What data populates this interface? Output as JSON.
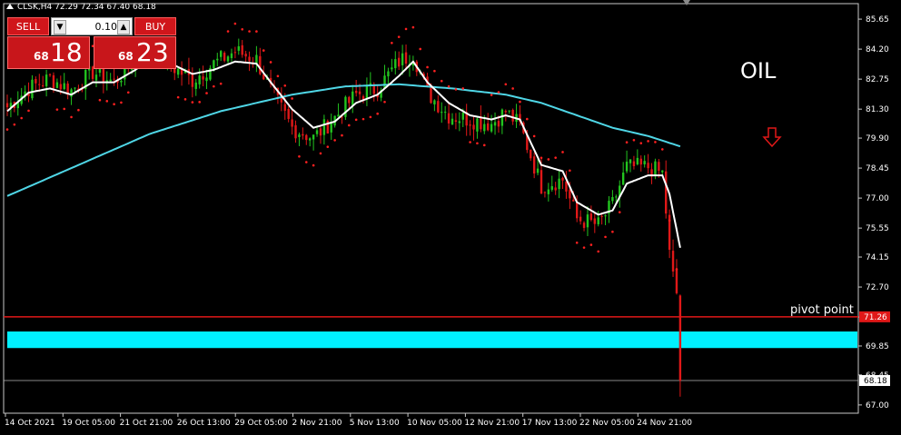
{
  "header": {
    "symbol_info": "CLSK,H4  72.29 72.34 67.40 68.18"
  },
  "trade_panel": {
    "sell_label": "SELL",
    "buy_label": "BUY",
    "lot_value": "0.10",
    "sell_price_small": "68",
    "sell_price_big": "18",
    "buy_price_small": "68",
    "buy_price_big": "23"
  },
  "annotations": {
    "oil_text": "OIL",
    "pivot_text": "pivot point"
  },
  "colors": {
    "bull": "#22c41f",
    "bear": "#e01818",
    "ma_fast": "#ffffff",
    "ma_slow": "#4fd6e6",
    "sar": "#ff2020",
    "zone": "#00f0ff",
    "pivot_line": "#e01818"
  },
  "chart_data": {
    "type": "candlestick",
    "ylim": [
      66.6,
      86.4
    ],
    "y_ticks": [
      "85.65",
      "84.20",
      "82.75",
      "81.30",
      "79.90",
      "78.45",
      "77.00",
      "75.55",
      "74.15",
      "72.70",
      "71.25",
      "69.85",
      "68.45",
      "67.00"
    ],
    "x_ticks": [
      "14 Oct 2021",
      "19 Oct 05:00",
      "21 Oct 21:00",
      "26 Oct 13:00",
      "29 Oct 05:00",
      "2 Nov 21:00",
      "5 Nov 13:00",
      "10 Nov 05:00",
      "12 Nov 21:00",
      "17 Nov 13:00",
      "22 Nov 05:00",
      "24 Nov 21:00"
    ],
    "current_price": "68.18",
    "pivot_price": "71.26",
    "pivot_value": 71.26,
    "zone": [
      69.75,
      70.55
    ],
    "anchors": [
      [
        0,
        81.4
      ],
      [
        6,
        82.3
      ],
      [
        12,
        82.8
      ],
      [
        18,
        82.2
      ],
      [
        24,
        83.1
      ],
      [
        30,
        82.6
      ],
      [
        36,
        83.7
      ],
      [
        40,
        84.2
      ],
      [
        46,
        83.4
      ],
      [
        52,
        82.7
      ],
      [
        58,
        83.5
      ],
      [
        64,
        84.1
      ],
      [
        70,
        83.7
      ],
      [
        74,
        82.2
      ],
      [
        80,
        80.4
      ],
      [
        86,
        79.9
      ],
      [
        92,
        80.9
      ],
      [
        98,
        82.0
      ],
      [
        104,
        82.3
      ],
      [
        110,
        83.6
      ],
      [
        114,
        84.0
      ],
      [
        118,
        82.1
      ],
      [
        124,
        81.0
      ],
      [
        130,
        80.8
      ],
      [
        136,
        80.6
      ],
      [
        140,
        81.2
      ],
      [
        144,
        80.5
      ],
      [
        150,
        77.6
      ],
      [
        156,
        77.9
      ],
      [
        160,
        76.0
      ],
      [
        166,
        75.7
      ],
      [
        170,
        76.7
      ],
      [
        174,
        78.5
      ],
      [
        180,
        78.5
      ],
      [
        184,
        78.2
      ],
      [
        186,
        74.5
      ],
      [
        188,
        72.4
      ],
      [
        189,
        68.2
      ]
    ],
    "ma_slow": [
      [
        0,
        77.1
      ],
      [
        20,
        78.6
      ],
      [
        40,
        80.1
      ],
      [
        60,
        81.2
      ],
      [
        80,
        82.0
      ],
      [
        95,
        82.4
      ],
      [
        110,
        82.5
      ],
      [
        125,
        82.3
      ],
      [
        140,
        82.0
      ],
      [
        150,
        81.6
      ],
      [
        160,
        81.0
      ],
      [
        170,
        80.4
      ],
      [
        180,
        80.0
      ],
      [
        189,
        79.5
      ]
    ],
    "ma_fast": [
      [
        0,
        81.2
      ],
      [
        6,
        82.1
      ],
      [
        12,
        82.3
      ],
      [
        18,
        82.0
      ],
      [
        24,
        82.6
      ],
      [
        30,
        82.6
      ],
      [
        36,
        83.2
      ],
      [
        40,
        83.7
      ],
      [
        46,
        83.5
      ],
      [
        52,
        83.0
      ],
      [
        58,
        83.2
      ],
      [
        64,
        83.6
      ],
      [
        70,
        83.5
      ],
      [
        74,
        82.6
      ],
      [
        80,
        81.3
      ],
      [
        86,
        80.4
      ],
      [
        92,
        80.7
      ],
      [
        98,
        81.6
      ],
      [
        104,
        82.0
      ],
      [
        110,
        82.9
      ],
      [
        114,
        83.6
      ],
      [
        118,
        82.6
      ],
      [
        124,
        81.6
      ],
      [
        130,
        81.0
      ],
      [
        136,
        80.8
      ],
      [
        140,
        81.0
      ],
      [
        144,
        80.8
      ],
      [
        150,
        78.6
      ],
      [
        156,
        78.3
      ],
      [
        160,
        76.8
      ],
      [
        166,
        76.2
      ],
      [
        170,
        76.4
      ],
      [
        174,
        77.7
      ],
      [
        180,
        78.1
      ],
      [
        184,
        78.1
      ],
      [
        186,
        77.2
      ],
      [
        189,
        74.6
      ]
    ]
  }
}
